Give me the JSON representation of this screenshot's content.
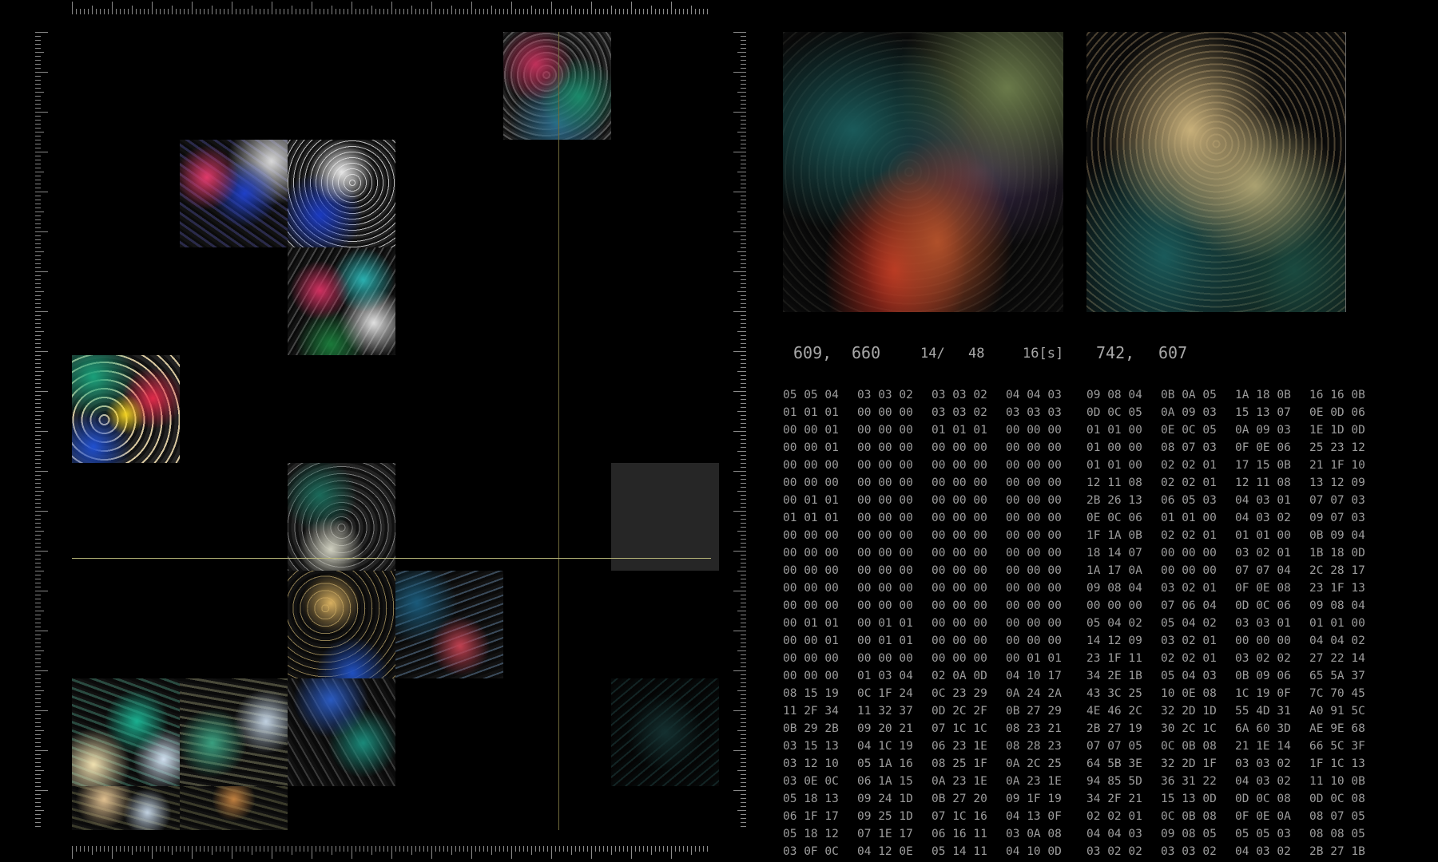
{
  "readout": {
    "coord_a_x": "609,",
    "coord_a_y": "660",
    "frame": "14/",
    "frame_total": "48",
    "duration": "16[s]",
    "coord_b_x": "742,",
    "coord_b_y": "607"
  },
  "hex_rows": [
    [
      "05 05 04",
      "03 03 02",
      "03 03 02",
      "04 04 03",
      "09 08 04",
      "0B 0A 05",
      "1A 18 0B",
      "16 16 0B"
    ],
    [
      "01 01 01",
      "00 00 00",
      "03 03 02",
      "03 03 03",
      "0D 0C 05",
      "0A 09 03",
      "15 13 07",
      "0E 0D 06"
    ],
    [
      "00 00 01",
      "00 00 00",
      "01 01 01",
      "00 00 00",
      "01 01 00",
      "0E 0C 05",
      "0A 09 03",
      "1E 1D 0D"
    ],
    [
      "00 00 01",
      "00 00 00",
      "00 00 00",
      "00 00 00",
      "01 00 00",
      "08 07 03",
      "0F 0E 06",
      "25 23 12"
    ],
    [
      "00 00 00",
      "00 00 00",
      "00 00 00",
      "00 00 00",
      "01 01 00",
      "02 02 01",
      "17 15 0B",
      "21 1F 10"
    ],
    [
      "00 00 00",
      "00 00 00",
      "00 00 00",
      "00 00 00",
      "12 11 08",
      "02 02 01",
      "12 11 08",
      "13 12 09"
    ],
    [
      "00 01 01",
      "00 00 00",
      "00 00 00",
      "00 00 00",
      "2B 26 13",
      "06 05 03",
      "04 03 01",
      "07 07 03"
    ],
    [
      "01 01 01",
      "00 00 00",
      "00 00 00",
      "00 00 00",
      "0E 0C 06",
      "01 01 00",
      "04 03 02",
      "09 07 03"
    ],
    [
      "00 00 00",
      "00 00 00",
      "00 00 00",
      "00 00 00",
      "1F 1A 0B",
      "02 02 01",
      "01 01 00",
      "0B 09 04"
    ],
    [
      "00 00 00",
      "00 00 00",
      "00 00 00",
      "00 00 00",
      "18 14 07",
      "00 00 00",
      "03 02 01",
      "1B 18 0D"
    ],
    [
      "00 00 00",
      "00 00 00",
      "00 00 00",
      "00 00 00",
      "1A 17 0A",
      "00 00 00",
      "07 07 04",
      "2C 28 17"
    ],
    [
      "00 00 00",
      "00 00 00",
      "00 00 00",
      "00 00 00",
      "09 08 04",
      "03 02 01",
      "0F 0E 08",
      "23 1F 13"
    ],
    [
      "00 00 00",
      "00 00 00",
      "00 00 00",
      "00 00 00",
      "00 00 00",
      "07 06 04",
      "0D 0C 06",
      "09 08 04"
    ],
    [
      "00 01 01",
      "00 01 01",
      "00 00 00",
      "00 00 00",
      "05 04 02",
      "05 04 02",
      "03 03 01",
      "01 01 00"
    ],
    [
      "00 00 01",
      "00 01 01",
      "00 00 00",
      "00 00 00",
      "14 12 09",
      "03 02 01",
      "00 00 00",
      "04 04 02"
    ],
    [
      "00 00 00",
      "00 00 00",
      "00 00 00",
      "00 01 01",
      "23 1F 11",
      "02 02 01",
      "03 02 02",
      "27 22 14"
    ],
    [
      "00 00 00",
      "01 03 04",
      "02 0A 0D",
      "04 10 17",
      "34 2E 1B",
      "05 04 03",
      "0B 09 06",
      "65 5A 37"
    ],
    [
      "08 15 19",
      "0C 1F 24",
      "0C 23 29",
      "0A 24 2A",
      "43 3C 25",
      "10 0E 08",
      "1C 19 0F",
      "7C 70 45"
    ],
    [
      "11 2F 34",
      "11 32 37",
      "0D 2C 2F",
      "0B 27 29",
      "4E 46 2C",
      "32 2D 1D",
      "55 4D 31",
      "A0 91 5C"
    ],
    [
      "0B 29 2B",
      "09 20 21",
      "07 1C 1C",
      "08 23 21",
      "2B 27 19",
      "30 2C 1C",
      "6A 60 3D",
      "AE 9E 68"
    ],
    [
      "03 15 13",
      "04 1C 19",
      "06 23 1E",
      "08 28 23",
      "07 07 05",
      "0C 0B 08",
      "21 1E 14",
      "66 5C 3F"
    ],
    [
      "03 12 10",
      "05 1A 16",
      "08 25 1F",
      "0A 2C 25",
      "64 5B 3E",
      "32 2D 1F",
      "03 03 02",
      "1F 1C 13"
    ],
    [
      "03 0E 0C",
      "06 1A 15",
      "0A 23 1E",
      "0A 23 1E",
      "94 85 5D",
      "36 31 22",
      "04 03 02",
      "11 10 0B"
    ],
    [
      "05 18 13",
      "09 24 1D",
      "0B 27 20",
      "09 1F 19",
      "34 2F 21",
      "15 13 0D",
      "0D 0C 08",
      "0D 0C 08"
    ],
    [
      "06 1F 17",
      "09 25 1D",
      "07 1C 16",
      "04 13 0F",
      "02 02 01",
      "0C 0B 08",
      "0F 0E 0A",
      "08 07 05"
    ],
    [
      "05 18 12",
      "07 1E 17",
      "06 16 11",
      "03 0A 08",
      "04 04 03",
      "09 08 05",
      "05 05 03",
      "08 08 05"
    ],
    [
      "03 0F 0C",
      "04 12 0E",
      "05 14 11",
      "04 10 0D",
      "03 02 02",
      "03 03 02",
      "04 03 02",
      "2B 27 1B"
    ]
  ]
}
